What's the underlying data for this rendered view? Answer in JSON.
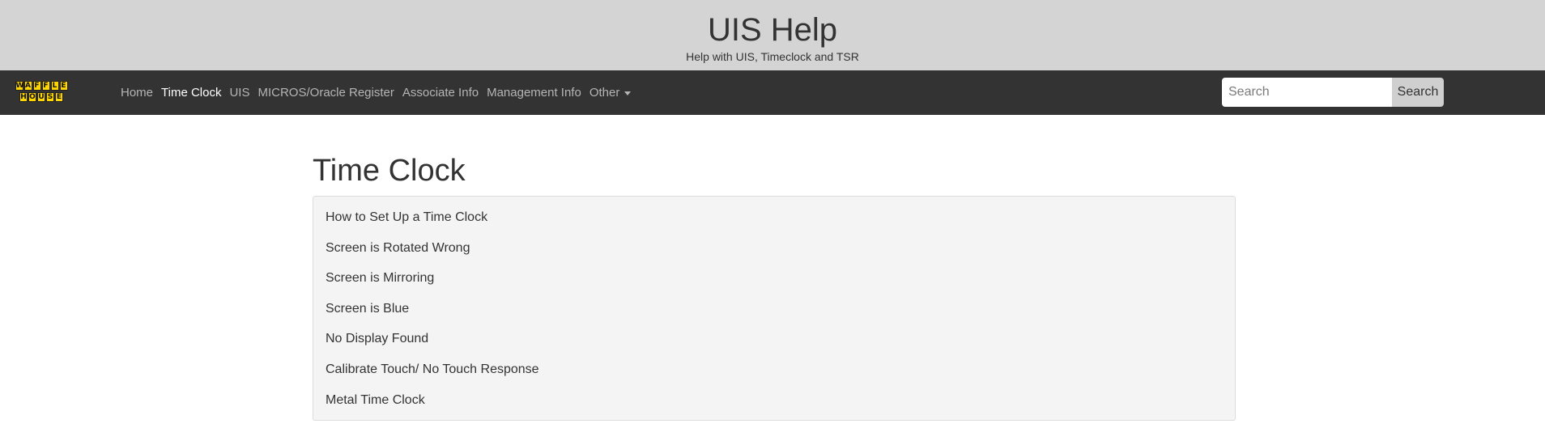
{
  "header": {
    "title": "UIS Help",
    "subtitle": "Help with UIS, Timeclock and TSR"
  },
  "navbar": {
    "logo": {
      "row1": [
        "W",
        "A",
        "F",
        "F",
        "L",
        "E"
      ],
      "row2": [
        "H",
        "O",
        "U",
        "S",
        "E"
      ],
      "colors": {
        "tile": "#ffd600",
        "text": "#111111"
      }
    },
    "links": [
      {
        "label": "Home"
      },
      {
        "label": "Time Clock",
        "active": true
      },
      {
        "label": "UIS"
      },
      {
        "label": "MICROS/Oracle Register"
      },
      {
        "label": "Associate Info"
      },
      {
        "label": "Management Info"
      },
      {
        "label": "Other",
        "dropdown": true
      }
    ],
    "search": {
      "placeholder": "Search",
      "button_label": "Search"
    }
  },
  "main": {
    "title": "Time Clock",
    "items": [
      "How to Set Up a Time Clock",
      "Screen is Rotated Wrong",
      "Screen is Mirroring",
      "Screen is Blue",
      "No Display Found",
      "Calibrate Touch/ No Touch Response",
      "Metal Time Clock"
    ]
  },
  "colors": {
    "header_bg": "#d4d4d4",
    "navbar_bg": "#333333",
    "nav_link": "#b5b5b5",
    "nav_link_active": "#ffffff",
    "list_bg": "#f4f4f4"
  }
}
